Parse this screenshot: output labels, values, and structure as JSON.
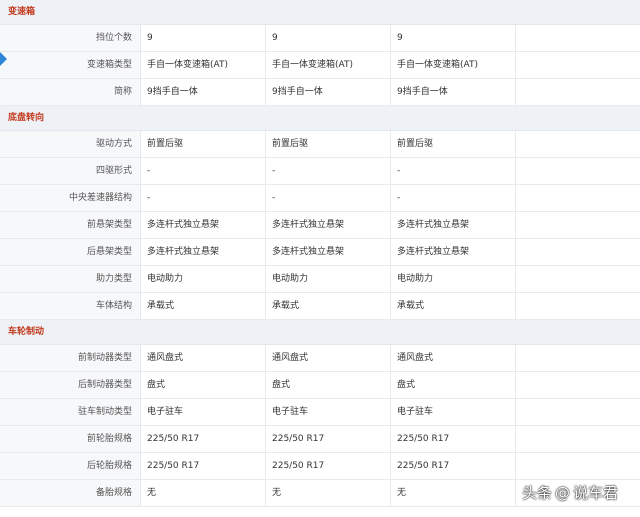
{
  "sections": [
    {
      "title": "变速箱",
      "rows": [
        {
          "label": "挡位个数",
          "values": [
            "9",
            "9",
            "9"
          ]
        },
        {
          "label": "变速箱类型",
          "values": [
            "手自一体变速箱(AT)",
            "手自一体变速箱(AT)",
            "手自一体变速箱(AT)"
          ]
        },
        {
          "label": "简称",
          "values": [
            "9挡手自一体",
            "9挡手自一体",
            "9挡手自一体"
          ]
        }
      ]
    },
    {
      "title": "底盘转向",
      "rows": [
        {
          "label": "驱动方式",
          "values": [
            "前置后驱",
            "前置后驱",
            "前置后驱"
          ]
        },
        {
          "label": "四驱形式",
          "values": [
            "-",
            "-",
            "-"
          ]
        },
        {
          "label": "中央差速器结构",
          "values": [
            "-",
            "-",
            "-"
          ]
        },
        {
          "label": "前悬架类型",
          "values": [
            "多连杆式独立悬架",
            "多连杆式独立悬架",
            "多连杆式独立悬架"
          ]
        },
        {
          "label": "后悬架类型",
          "values": [
            "多连杆式独立悬架",
            "多连杆式独立悬架",
            "多连杆式独立悬架"
          ]
        },
        {
          "label": "助力类型",
          "values": [
            "电动助力",
            "电动助力",
            "电动助力"
          ]
        },
        {
          "label": "车体结构",
          "values": [
            "承载式",
            "承载式",
            "承载式"
          ]
        }
      ]
    },
    {
      "title": "车轮制动",
      "rows": [
        {
          "label": "前制动器类型",
          "values": [
            "通风盘式",
            "通风盘式",
            "通风盘式"
          ]
        },
        {
          "label": "后制动器类型",
          "values": [
            "盘式",
            "盘式",
            "盘式"
          ]
        },
        {
          "label": "驻车制动类型",
          "values": [
            "电子驻车",
            "电子驻车",
            "电子驻车"
          ]
        },
        {
          "label": "前轮胎规格",
          "values": [
            "225/50 R17",
            "225/50 R17",
            "225/50 R17"
          ]
        },
        {
          "label": "后轮胎规格",
          "values": [
            "225/50 R17",
            "225/50 R17",
            "225/50 R17"
          ]
        },
        {
          "label": "备胎规格",
          "values": [
            "无",
            "无",
            "无"
          ]
        }
      ]
    }
  ],
  "watermark": {
    "platform": "头条",
    "at": "@",
    "account": "说车君"
  },
  "colors": {
    "section_title": "#c23a1e",
    "pointer": "#2f86d6"
  }
}
